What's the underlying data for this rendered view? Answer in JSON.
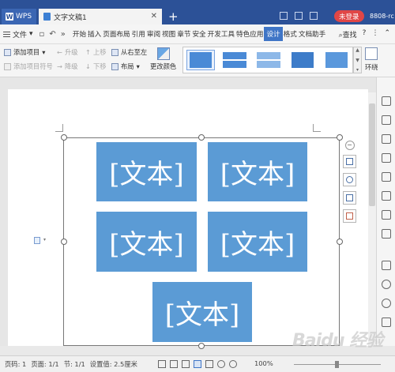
{
  "titlebar": {
    "app_tab": "WPS",
    "doc_tab": "文字文稿1",
    "login_button": "未登录",
    "user_id": "8808-rc"
  },
  "menubar": {
    "file": "文件",
    "items": [
      "开始",
      "插入",
      "页面布局",
      "引用",
      "审阅",
      "视图",
      "章节",
      "安全",
      "开发工具",
      "特色应用",
      "设计",
      "格式",
      "文档助手"
    ],
    "active_item": "设计",
    "search": "查找",
    "help": "?"
  },
  "ribbon": {
    "add_item": "添加项目",
    "add_item_before": "添加项目符号",
    "promote": "升级",
    "demote": "降级",
    "move_up": "上移",
    "move_down": "下移",
    "right_to_left": "从右至左",
    "layout": "布局",
    "change_color": "更改颜色",
    "wrap": "环绕"
  },
  "diagram": {
    "node_text": "[文本]",
    "node_color": "#5b9bd5",
    "node_count": 5
  },
  "statusbar": {
    "page_num": "页码: 1",
    "pages": "页面: 1/1",
    "section": "节: 1/1",
    "setting": "设置值: 2.5厘米",
    "zoom": "100%"
  },
  "watermark": "Baidu 经验"
}
